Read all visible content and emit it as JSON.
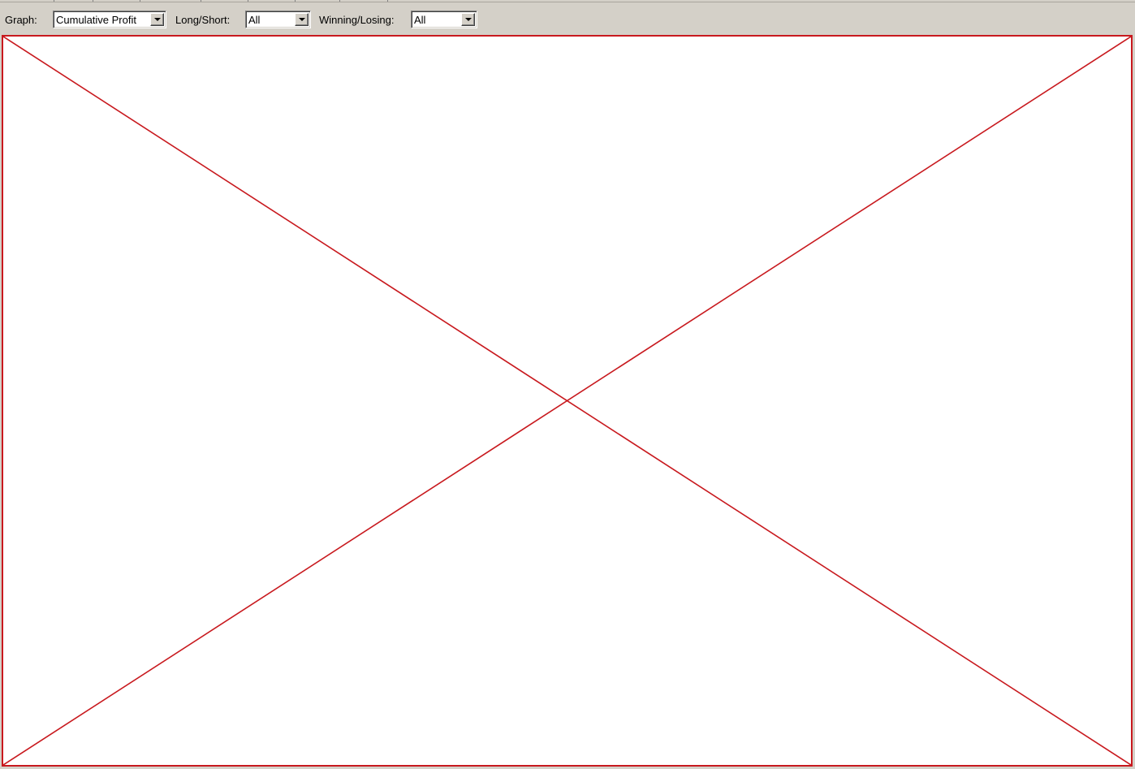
{
  "toolbar": {
    "graph": {
      "label": "Graph:",
      "value": "Cumulative Profit"
    },
    "long_short": {
      "label": "Long/Short:",
      "value": "All"
    },
    "winning_losing": {
      "label": "Winning/Losing:",
      "value": "All"
    }
  },
  "graph_area": {
    "state": "missing-image-placeholder",
    "icon": "red-x-placeholder-icon",
    "color": "#c8191e"
  }
}
